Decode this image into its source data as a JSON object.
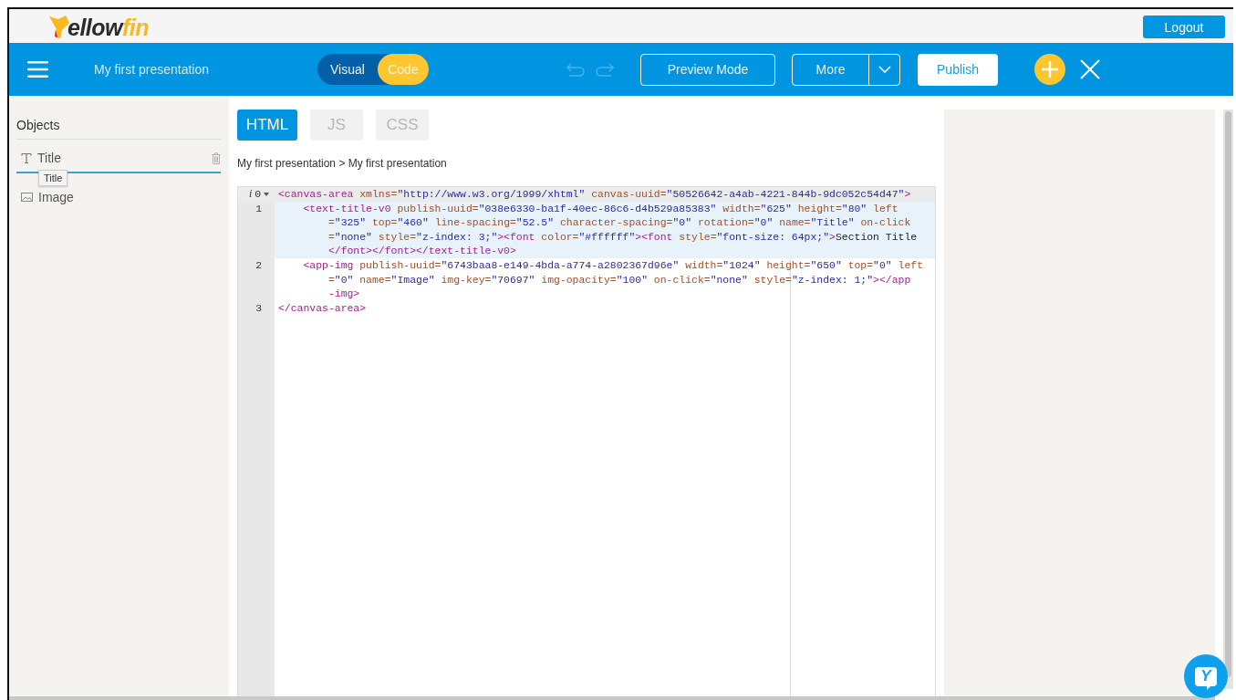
{
  "header": {
    "logo_text": "ellowfin",
    "logout": "Logout"
  },
  "toolbar": {
    "title": "My first presentation",
    "mode_toggle": [
      {
        "label": "Visual",
        "selected": false
      },
      {
        "label": "Code",
        "selected": true
      }
    ],
    "undo_disabled": true,
    "redo_disabled": true,
    "preview": "Preview Mode",
    "more": "More",
    "publish": "Publish"
  },
  "sidebar": {
    "heading": "Objects",
    "items": [
      {
        "label": "Title",
        "kind": "text",
        "selected": true
      },
      {
        "label": "Image",
        "kind": "image",
        "selected": false
      }
    ],
    "tooltip": "Title"
  },
  "editor": {
    "tabs": [
      {
        "label": "HTML",
        "selected": true
      },
      {
        "label": "JS",
        "selected": false
      },
      {
        "label": "CSS",
        "selected": false
      }
    ],
    "breadcrumb": "My first presentation > My first presentation",
    "lines": [
      {
        "number": "0",
        "info": "i",
        "foldable": true,
        "cursor": true,
        "selected": false,
        "rows": [
          {
            "tokens": [
              {
                "kind": "tag",
                "text": "<canvas-area"
              },
              {
                "kind": "attr",
                "text": " xmlns="
              },
              {
                "kind": "val",
                "text": "\"http://www.w3.org/1999/xhtml\""
              },
              {
                "kind": "attr",
                "text": " canvas-uuid="
              },
              {
                "kind": "val",
                "text": "\"50526642-a4ab-4221-844b-9dc052c54d47\""
              },
              {
                "kind": "tag",
                "text": ">"
              }
            ]
          }
        ]
      },
      {
        "number": "1",
        "foldable": false,
        "cursor": false,
        "selected": true,
        "rows": [
          {
            "tokens": [
              {
                "kind": "tag",
                "text": "    <text-title-v0"
              },
              {
                "kind": "attr",
                "text": " publish-uuid="
              },
              {
                "kind": "val",
                "text": "\"038e6330-ba1f-40ec-86c6-d4b529a85383\""
              },
              {
                "kind": "attr",
                "text": " width="
              },
              {
                "kind": "val",
                "text": "\"625\""
              },
              {
                "kind": "attr",
                "text": " height="
              },
              {
                "kind": "val",
                "text": "\"80\""
              },
              {
                "kind": "attr",
                "text": " left"
              }
            ]
          },
          {
            "tokens": [
              {
                "kind": "attr",
                "text": "="
              },
              {
                "kind": "val",
                "text": "\"325\""
              },
              {
                "kind": "attr",
                "text": " top="
              },
              {
                "kind": "val",
                "text": "\"460\""
              },
              {
                "kind": "attr",
                "text": " line-spacing="
              },
              {
                "kind": "val",
                "text": "\"52.5\""
              },
              {
                "kind": "attr",
                "text": " character-spacing="
              },
              {
                "kind": "val",
                "text": "\"0\""
              },
              {
                "kind": "attr",
                "text": " rotation="
              },
              {
                "kind": "val",
                "text": "\"0\""
              },
              {
                "kind": "attr",
                "text": " name="
              },
              {
                "kind": "val",
                "text": "\"Title\""
              },
              {
                "kind": "attr",
                "text": " on-click"
              }
            ]
          },
          {
            "tokens": [
              {
                "kind": "attr",
                "text": "="
              },
              {
                "kind": "val",
                "text": "\"none\""
              },
              {
                "kind": "attr",
                "text": " style="
              },
              {
                "kind": "val",
                "text": "\"z-index: 3;\""
              },
              {
                "kind": "tag",
                "text": "><font"
              },
              {
                "kind": "attr",
                "text": " color="
              },
              {
                "kind": "val",
                "text": "\"#ffffff\""
              },
              {
                "kind": "tag",
                "text": "><font"
              },
              {
                "kind": "attr",
                "text": " style="
              },
              {
                "kind": "val",
                "text": "\"font-size: 64px;\""
              },
              {
                "kind": "tag",
                "text": ">"
              },
              {
                "kind": "plain",
                "text": "Section Title"
              }
            ]
          },
          {
            "tokens": [
              {
                "kind": "tag",
                "text": "</font></font></text-title-v0>"
              }
            ]
          }
        ]
      },
      {
        "number": "2",
        "foldable": false,
        "cursor": false,
        "selected": false,
        "rows": [
          {
            "tokens": [
              {
                "kind": "tag",
                "text": "    <app-img"
              },
              {
                "kind": "attr",
                "text": " publish-uuid="
              },
              {
                "kind": "val",
                "text": "\"6743baa8-e149-4bda-a774-a2802367d96e\""
              },
              {
                "kind": "attr",
                "text": " width="
              },
              {
                "kind": "val",
                "text": "\"1024\""
              },
              {
                "kind": "attr",
                "text": " height="
              },
              {
                "kind": "val",
                "text": "\"650\""
              },
              {
                "kind": "attr",
                "text": " top="
              },
              {
                "kind": "val",
                "text": "\"0\""
              },
              {
                "kind": "attr",
                "text": " left"
              }
            ]
          },
          {
            "tokens": [
              {
                "kind": "attr",
                "text": "="
              },
              {
                "kind": "val",
                "text": "\"0\""
              },
              {
                "kind": "attr",
                "text": " name="
              },
              {
                "kind": "val",
                "text": "\"Image\""
              },
              {
                "kind": "attr",
                "text": " img-key="
              },
              {
                "kind": "val",
                "text": "\"70697\""
              },
              {
                "kind": "attr",
                "text": " img-opacity="
              },
              {
                "kind": "val",
                "text": "\"100\""
              },
              {
                "kind": "attr",
                "text": " on-click="
              },
              {
                "kind": "val",
                "text": "\"none\""
              },
              {
                "kind": "attr",
                "text": " style="
              },
              {
                "kind": "val",
                "text": "\"z-index: 1;\""
              },
              {
                "kind": "tag",
                "text": "></app"
              }
            ]
          },
          {
            "tokens": [
              {
                "kind": "tag",
                "text": "-img>"
              }
            ]
          }
        ]
      },
      {
        "number": "3",
        "foldable": false,
        "cursor": false,
        "selected": false,
        "rows": [
          {
            "tokens": [
              {
                "kind": "tag",
                "text": "</canvas-area>"
              }
            ]
          }
        ]
      }
    ]
  },
  "chat_button": {
    "label": "Y"
  }
}
